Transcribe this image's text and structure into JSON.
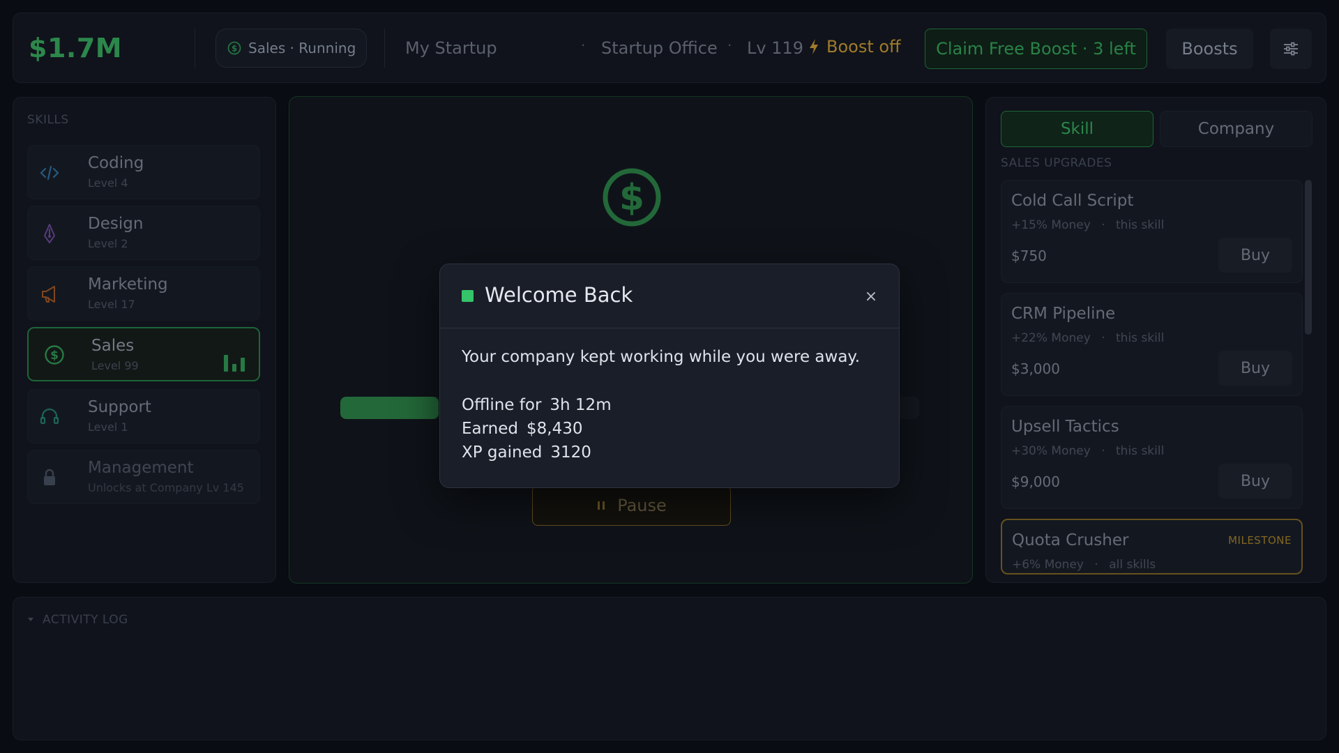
{
  "header": {
    "money": "$1.7M",
    "status_pill": "Sales · Running",
    "company_name": "My Startup",
    "separator": "·",
    "office": "Startup Office",
    "level": "Lv 119",
    "boost_status": "Boost off",
    "claim_button": "Claim Free Boost · 3 left",
    "boosts_button": "Boosts"
  },
  "skills": {
    "title": "SKILLS",
    "items": [
      {
        "name": "Coding",
        "level": "Level 4",
        "icon": "code-icon"
      },
      {
        "name": "Design",
        "level": "Level 2",
        "icon": "pen-nib-icon"
      },
      {
        "name": "Marketing",
        "level": "Level 17",
        "icon": "megaphone-icon"
      },
      {
        "name": "Sales",
        "level": "Level 99",
        "icon": "dollar-icon",
        "active": true
      },
      {
        "name": "Support",
        "level": "Level 1",
        "icon": "headset-icon"
      },
      {
        "name": "Management",
        "level": "Unlocks at Company Lv 145",
        "icon": "lock-icon",
        "locked": true
      }
    ]
  },
  "center": {
    "progress_fraction": 0.17,
    "pause_label": "Pause"
  },
  "upgrades": {
    "tabs": [
      "Skill",
      "Company"
    ],
    "section_title": "SALES UPGRADES",
    "items": [
      {
        "name": "Cold Call Script",
        "effect": "+15% Money",
        "scope": "this skill",
        "price": "$750",
        "buy": "Buy"
      },
      {
        "name": "CRM Pipeline",
        "effect": "+22% Money",
        "scope": "this skill",
        "price": "$3,000",
        "buy": "Buy"
      },
      {
        "name": "Upsell Tactics",
        "effect": "+30% Money",
        "scope": "this skill",
        "price": "$9,000",
        "buy": "Buy"
      },
      {
        "name": "Quota Crusher",
        "effect": "+6% Money",
        "scope": "all skills",
        "tag": "MILESTONE"
      }
    ]
  },
  "activity": {
    "title": "ACTIVITY LOG"
  },
  "modal": {
    "title": "Welcome Back",
    "close": "×",
    "message": "Your company kept working while you were away.",
    "stats": [
      {
        "label": "Offline for",
        "value": "3h 12m"
      },
      {
        "label": "Earned",
        "value": "$8,430"
      },
      {
        "label": "XP gained",
        "value": "3120"
      }
    ]
  },
  "colors": {
    "accent_green": "#2f8f50",
    "boost_amber": "#a8822d",
    "modal_indicator": "#35c46a"
  }
}
